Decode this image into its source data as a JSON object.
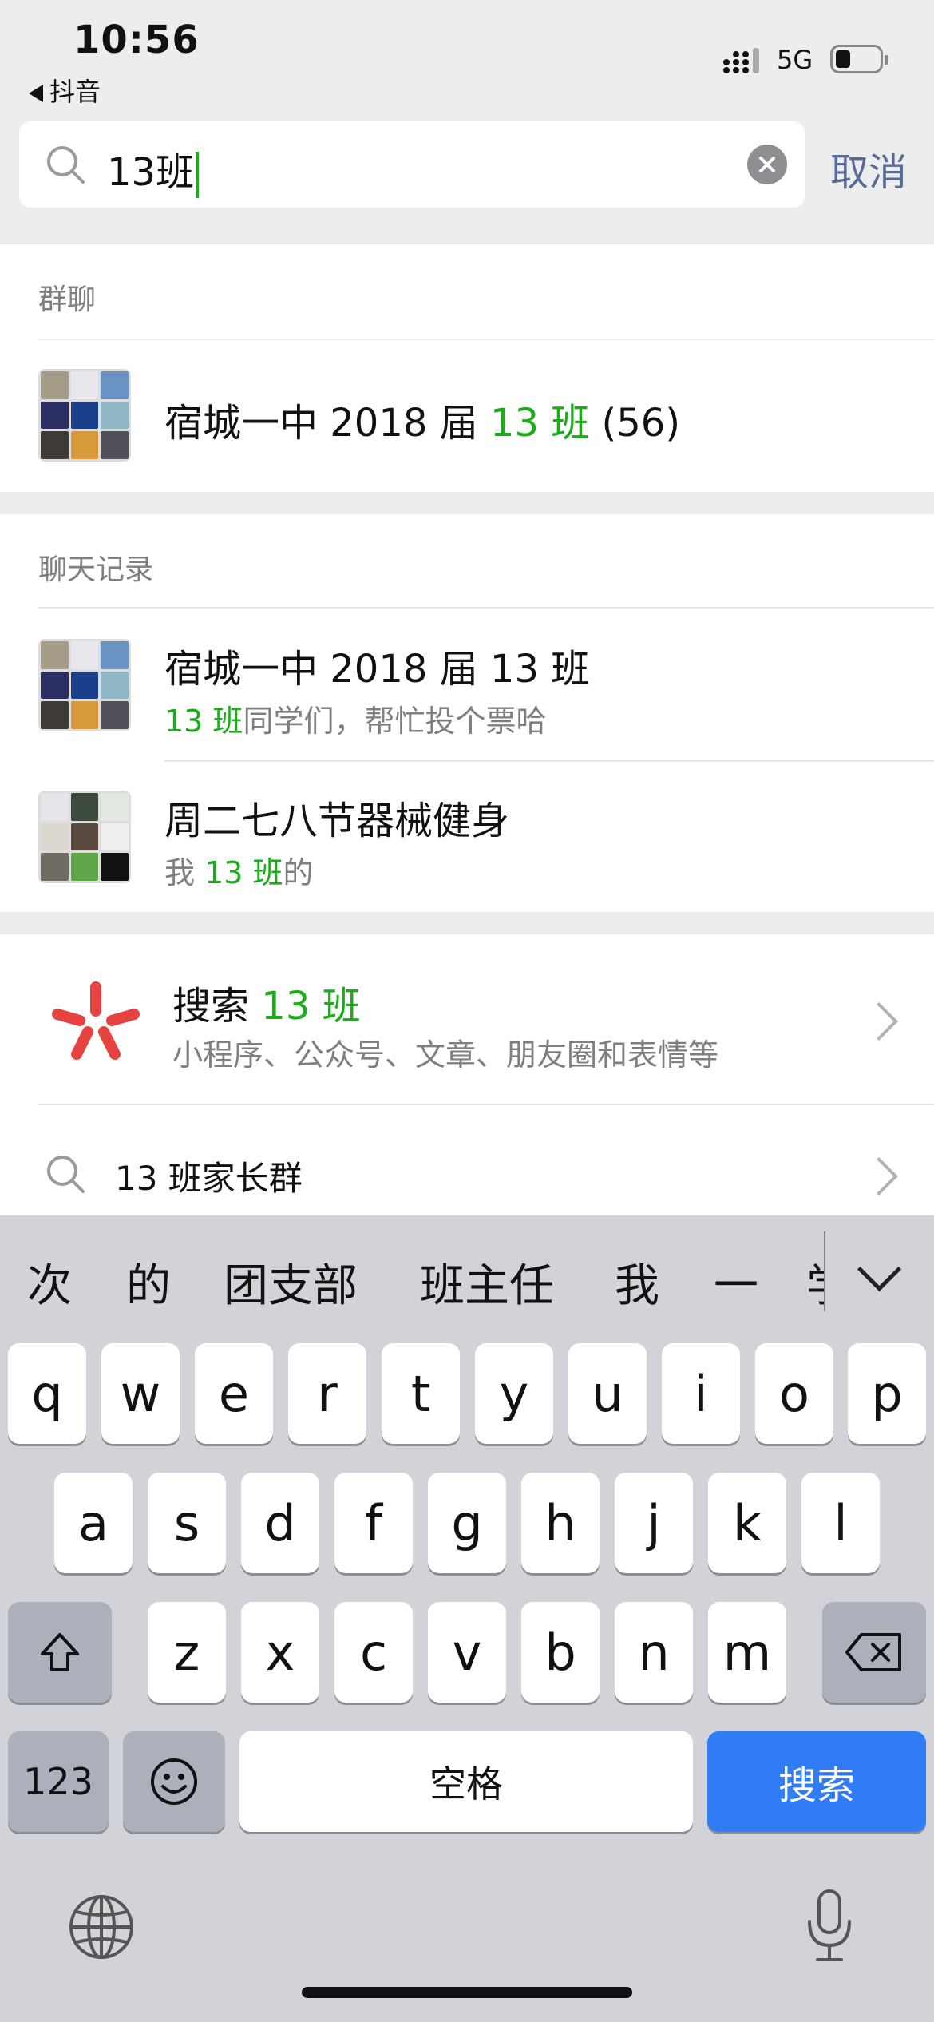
{
  "status_bar": {
    "time": "10:56",
    "back_app": "抖音",
    "network": "5G"
  },
  "search": {
    "query": "13班",
    "cancel_label": "取消"
  },
  "group_chats": {
    "label": "群聊",
    "items": [
      {
        "name_prefix": "宿城一中 2018 届 ",
        "match": "13 班",
        "count": " (56)"
      }
    ]
  },
  "chat_records": {
    "label": "聊天记录",
    "items": [
      {
        "name": "宿城一中 2018 届 13 班",
        "snippet_pre": "",
        "snippet_match": "13 班",
        "snippet_post": "同学们，帮忙投个票哈"
      },
      {
        "name": "周二七八节器械健身",
        "snippet_pre": "我 ",
        "snippet_match": "13 班",
        "snippet_post": "的"
      }
    ]
  },
  "search_more": {
    "title": "搜索",
    "query": "13 班",
    "subtitle": "小程序、公众号、文章、朋友圈和表情等",
    "suggestion": "13 班家长群",
    "brand_color": "#e64340"
  },
  "keyboard": {
    "candidates": [
      "次",
      "的",
      "团支部",
      "班主任",
      "我",
      "一",
      "学"
    ],
    "row1": [
      "q",
      "w",
      "e",
      "r",
      "t",
      "y",
      "u",
      "i",
      "o",
      "p"
    ],
    "row2": [
      "a",
      "s",
      "d",
      "f",
      "g",
      "h",
      "j",
      "k",
      "l"
    ],
    "row3": [
      "z",
      "x",
      "c",
      "v",
      "b",
      "n",
      "m"
    ],
    "numbers_label": "123",
    "space_label": "空格",
    "search_label": "搜索",
    "accent_color": "#2f7cf6"
  }
}
